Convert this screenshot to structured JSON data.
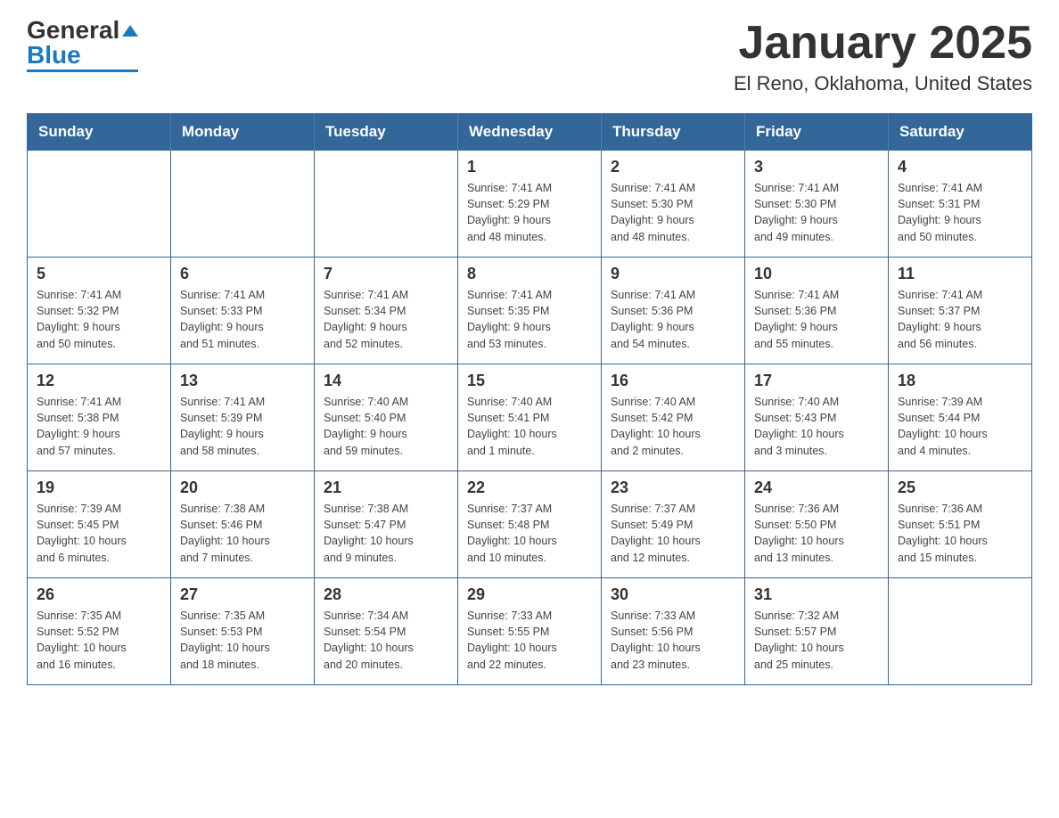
{
  "header": {
    "logo_line1": "General",
    "logo_line2": "Blue",
    "title": "January 2025",
    "subtitle": "El Reno, Oklahoma, United States"
  },
  "calendar": {
    "days_of_week": [
      "Sunday",
      "Monday",
      "Tuesday",
      "Wednesday",
      "Thursday",
      "Friday",
      "Saturday"
    ],
    "weeks": [
      [
        {
          "day": "",
          "info": ""
        },
        {
          "day": "",
          "info": ""
        },
        {
          "day": "",
          "info": ""
        },
        {
          "day": "1",
          "info": "Sunrise: 7:41 AM\nSunset: 5:29 PM\nDaylight: 9 hours\nand 48 minutes."
        },
        {
          "day": "2",
          "info": "Sunrise: 7:41 AM\nSunset: 5:30 PM\nDaylight: 9 hours\nand 48 minutes."
        },
        {
          "day": "3",
          "info": "Sunrise: 7:41 AM\nSunset: 5:30 PM\nDaylight: 9 hours\nand 49 minutes."
        },
        {
          "day": "4",
          "info": "Sunrise: 7:41 AM\nSunset: 5:31 PM\nDaylight: 9 hours\nand 50 minutes."
        }
      ],
      [
        {
          "day": "5",
          "info": "Sunrise: 7:41 AM\nSunset: 5:32 PM\nDaylight: 9 hours\nand 50 minutes."
        },
        {
          "day": "6",
          "info": "Sunrise: 7:41 AM\nSunset: 5:33 PM\nDaylight: 9 hours\nand 51 minutes."
        },
        {
          "day": "7",
          "info": "Sunrise: 7:41 AM\nSunset: 5:34 PM\nDaylight: 9 hours\nand 52 minutes."
        },
        {
          "day": "8",
          "info": "Sunrise: 7:41 AM\nSunset: 5:35 PM\nDaylight: 9 hours\nand 53 minutes."
        },
        {
          "day": "9",
          "info": "Sunrise: 7:41 AM\nSunset: 5:36 PM\nDaylight: 9 hours\nand 54 minutes."
        },
        {
          "day": "10",
          "info": "Sunrise: 7:41 AM\nSunset: 5:36 PM\nDaylight: 9 hours\nand 55 minutes."
        },
        {
          "day": "11",
          "info": "Sunrise: 7:41 AM\nSunset: 5:37 PM\nDaylight: 9 hours\nand 56 minutes."
        }
      ],
      [
        {
          "day": "12",
          "info": "Sunrise: 7:41 AM\nSunset: 5:38 PM\nDaylight: 9 hours\nand 57 minutes."
        },
        {
          "day": "13",
          "info": "Sunrise: 7:41 AM\nSunset: 5:39 PM\nDaylight: 9 hours\nand 58 minutes."
        },
        {
          "day": "14",
          "info": "Sunrise: 7:40 AM\nSunset: 5:40 PM\nDaylight: 9 hours\nand 59 minutes."
        },
        {
          "day": "15",
          "info": "Sunrise: 7:40 AM\nSunset: 5:41 PM\nDaylight: 10 hours\nand 1 minute."
        },
        {
          "day": "16",
          "info": "Sunrise: 7:40 AM\nSunset: 5:42 PM\nDaylight: 10 hours\nand 2 minutes."
        },
        {
          "day": "17",
          "info": "Sunrise: 7:40 AM\nSunset: 5:43 PM\nDaylight: 10 hours\nand 3 minutes."
        },
        {
          "day": "18",
          "info": "Sunrise: 7:39 AM\nSunset: 5:44 PM\nDaylight: 10 hours\nand 4 minutes."
        }
      ],
      [
        {
          "day": "19",
          "info": "Sunrise: 7:39 AM\nSunset: 5:45 PM\nDaylight: 10 hours\nand 6 minutes."
        },
        {
          "day": "20",
          "info": "Sunrise: 7:38 AM\nSunset: 5:46 PM\nDaylight: 10 hours\nand 7 minutes."
        },
        {
          "day": "21",
          "info": "Sunrise: 7:38 AM\nSunset: 5:47 PM\nDaylight: 10 hours\nand 9 minutes."
        },
        {
          "day": "22",
          "info": "Sunrise: 7:37 AM\nSunset: 5:48 PM\nDaylight: 10 hours\nand 10 minutes."
        },
        {
          "day": "23",
          "info": "Sunrise: 7:37 AM\nSunset: 5:49 PM\nDaylight: 10 hours\nand 12 minutes."
        },
        {
          "day": "24",
          "info": "Sunrise: 7:36 AM\nSunset: 5:50 PM\nDaylight: 10 hours\nand 13 minutes."
        },
        {
          "day": "25",
          "info": "Sunrise: 7:36 AM\nSunset: 5:51 PM\nDaylight: 10 hours\nand 15 minutes."
        }
      ],
      [
        {
          "day": "26",
          "info": "Sunrise: 7:35 AM\nSunset: 5:52 PM\nDaylight: 10 hours\nand 16 minutes."
        },
        {
          "day": "27",
          "info": "Sunrise: 7:35 AM\nSunset: 5:53 PM\nDaylight: 10 hours\nand 18 minutes."
        },
        {
          "day": "28",
          "info": "Sunrise: 7:34 AM\nSunset: 5:54 PM\nDaylight: 10 hours\nand 20 minutes."
        },
        {
          "day": "29",
          "info": "Sunrise: 7:33 AM\nSunset: 5:55 PM\nDaylight: 10 hours\nand 22 minutes."
        },
        {
          "day": "30",
          "info": "Sunrise: 7:33 AM\nSunset: 5:56 PM\nDaylight: 10 hours\nand 23 minutes."
        },
        {
          "day": "31",
          "info": "Sunrise: 7:32 AM\nSunset: 5:57 PM\nDaylight: 10 hours\nand 25 minutes."
        },
        {
          "day": "",
          "info": ""
        }
      ]
    ]
  }
}
